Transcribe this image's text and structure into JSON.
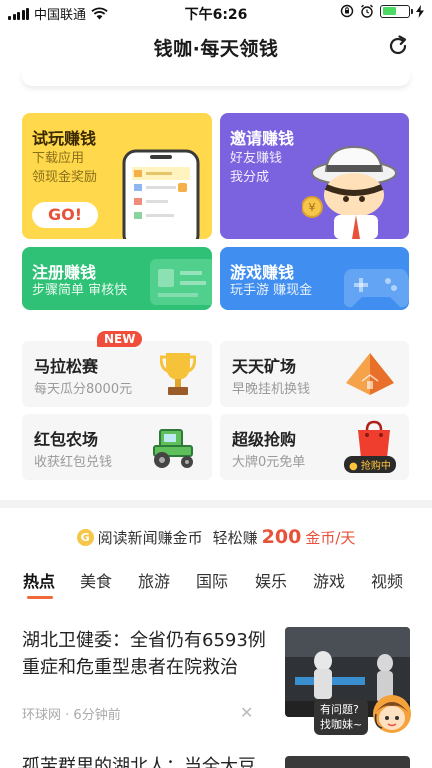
{
  "status_bar": {
    "carrier": "中国联通",
    "time": "下午6:26",
    "battery_level": 0.55
  },
  "header": {
    "title": "钱咖·每天领钱"
  },
  "cards": {
    "trial": {
      "title": "试玩赚钱",
      "sub1": "下载应用",
      "sub2": "领现金奖励",
      "button": "GO!"
    },
    "invite": {
      "title": "邀请赚钱",
      "sub1": "好友赚钱",
      "sub2": "我分成"
    },
    "register": {
      "title": "注册赚钱",
      "sub": "步骤简单 审核快"
    },
    "game": {
      "title": "游戏赚钱",
      "sub": "玩手游 赚现金"
    }
  },
  "tiles": {
    "marathon": {
      "title": "马拉松赛",
      "sub": "每天瓜分8000元",
      "badge": "NEW"
    },
    "mine": {
      "title": "天天矿场",
      "sub": "早晚挂机换钱"
    },
    "farm": {
      "title": "红包农场",
      "sub": "收获红包兑钱"
    },
    "deal": {
      "title": "超级抢购",
      "sub": "大牌0元免单",
      "badge": "● 抢购中"
    }
  },
  "promo": {
    "coin": "G",
    "text1": "阅读新闻赚金币",
    "text2": "轻松赚",
    "amount": "200",
    "unit": "金币/天"
  },
  "tabs": [
    "热点",
    "美食",
    "旅游",
    "国际",
    "娱乐",
    "游戏",
    "视频"
  ],
  "news": [
    {
      "title": "湖北卫健委：全省仍有6593例重症和危重型患者在院救治",
      "source": "环球网",
      "time": "6分钟前"
    },
    {
      "title": "孤苦群里的湖北人：当全大豆"
    }
  ],
  "help": {
    "line1": "有问题?",
    "line2": "找咖妹~"
  },
  "colors": {
    "accent": "#e8523a",
    "trial": "#ffd84b",
    "invite": "#7b63e0",
    "register": "#2fc276",
    "game": "#3f8ef0"
  }
}
